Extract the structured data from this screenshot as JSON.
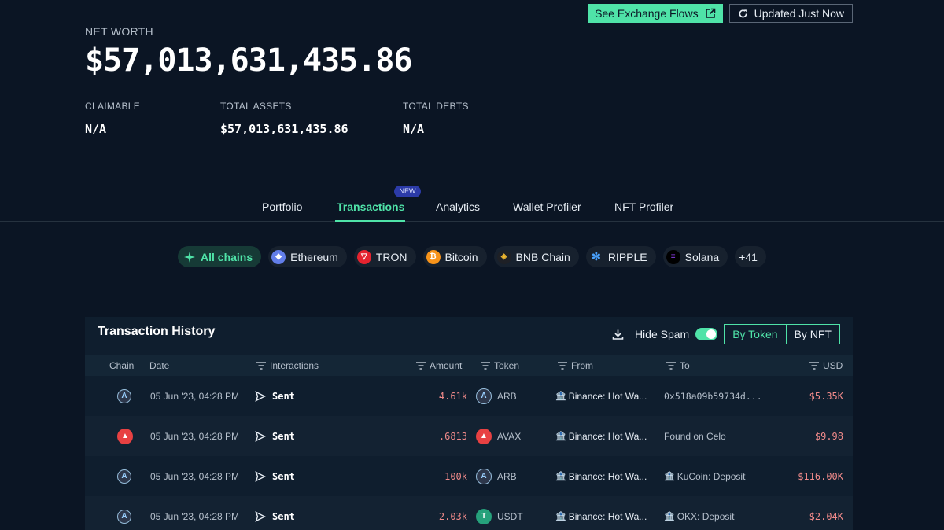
{
  "header": {
    "exchange_flows_label": "See Exchange Flows",
    "updated_label": "Updated Just Now",
    "net_worth_label": "NET WORTH",
    "net_worth_value": "$57,013,631,435.86",
    "stats": [
      {
        "label": "CLAIMABLE",
        "value": "N/A"
      },
      {
        "label": "TOTAL ASSETS",
        "value": "$57,013,631,435.86"
      },
      {
        "label": "TOTAL DEBTS",
        "value": "N/A"
      }
    ]
  },
  "tabs": [
    {
      "label": "Portfolio"
    },
    {
      "label": "Transactions",
      "badge": "NEW",
      "active": true
    },
    {
      "label": "Analytics"
    },
    {
      "label": "Wallet Profiler"
    },
    {
      "label": "NFT Profiler"
    }
  ],
  "chains": [
    {
      "label": "All chains",
      "active": true,
      "icon": "sparkle-icon"
    },
    {
      "label": "Ethereum",
      "icon": "ethereum-icon",
      "color": "#627eea"
    },
    {
      "label": "TRON",
      "icon": "tron-icon",
      "color": "#e5232f"
    },
    {
      "label": "Bitcoin",
      "icon": "bitcoin-icon",
      "color": "#f7931a"
    },
    {
      "label": "BNB Chain",
      "icon": "bnb-icon",
      "color": "#f3ba2f"
    },
    {
      "label": "RIPPLE",
      "icon": "ripple-icon",
      "color": "#4aa3ff"
    },
    {
      "label": "Solana",
      "icon": "solana-icon",
      "color": "#9945ff"
    },
    {
      "label": "+41"
    }
  ],
  "history": {
    "title": "Transaction History",
    "hide_spam_label": "Hide Spam",
    "hide_spam_on": true,
    "view_toggle": [
      "By Token",
      "By NFT"
    ],
    "columns": [
      "Chain",
      "Date",
      "Interactions",
      "Amount",
      "Token",
      "From",
      "To",
      "USD"
    ],
    "rows": [
      {
        "chain_icon": "arbitrum-icon",
        "date": "05 Jun '23, 04:28 PM",
        "interaction": "Sent",
        "amount": "4.61k",
        "token": "ARB",
        "token_icon": "arbitrum-icon",
        "from": "Binance: Hot Wa...",
        "to": "0x518a09b59734d...",
        "to_kind": "address",
        "usd": "$5.35K"
      },
      {
        "chain_icon": "avalanche-icon",
        "date": "05 Jun '23, 04:28 PM",
        "interaction": "Sent",
        "amount": ".6813",
        "token": "AVAX",
        "token_icon": "avalanche-icon",
        "from": "Binance: Hot Wa...",
        "to": "Found on Celo",
        "to_kind": "plain",
        "usd": "$9.98"
      },
      {
        "chain_icon": "arbitrum-icon",
        "date": "05 Jun '23, 04:28 PM",
        "interaction": "Sent",
        "amount": "100k",
        "token": "ARB",
        "token_icon": "arbitrum-icon",
        "from": "Binance: Hot Wa...",
        "to": "KuCoin: Deposit",
        "to_kind": "entity",
        "usd": "$116.00K"
      },
      {
        "chain_icon": "arbitrum-icon",
        "date": "05 Jun '23, 04:28 PM",
        "interaction": "Sent",
        "amount": "2.03k",
        "token": "USDT",
        "token_icon": "tether-icon",
        "from": "Binance: Hot Wa...",
        "to": "OKX: Deposit",
        "to_kind": "entity",
        "usd": "$2.04K"
      }
    ]
  },
  "colors": {
    "accent": "#4fe3a8",
    "negative": "#f08a8a",
    "background": "#0b1524",
    "badge": "#2c3ba8"
  }
}
